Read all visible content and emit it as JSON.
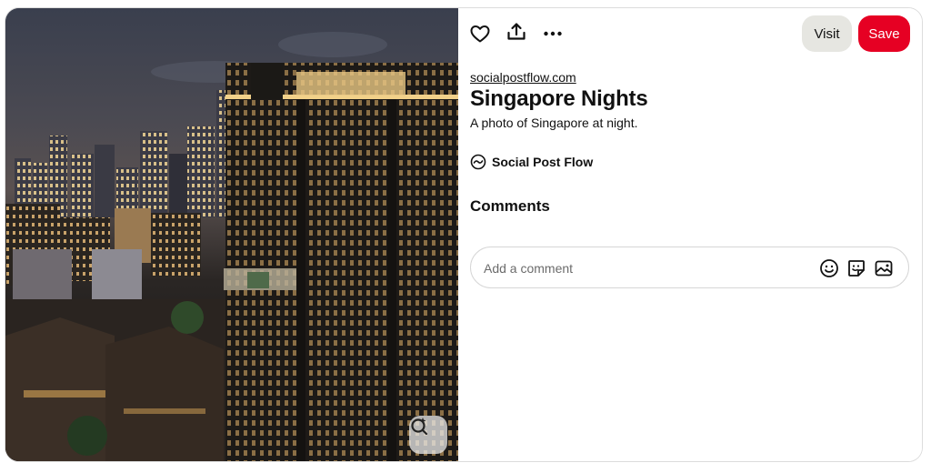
{
  "pin": {
    "source": "socialpostflow.com",
    "title": "Singapore Nights",
    "description": "A photo of Singapore at night."
  },
  "creator": {
    "name": "Social Post Flow"
  },
  "actions": {
    "visit_label": "Visit",
    "save_label": "Save",
    "like_icon": "heart-icon",
    "share_icon": "share-icon",
    "more_icon": "more-options-icon"
  },
  "comments": {
    "heading": "Comments",
    "placeholder": "Add a comment"
  },
  "colors": {
    "save_button": "#e60023",
    "visit_button": "#e6e6e1"
  }
}
